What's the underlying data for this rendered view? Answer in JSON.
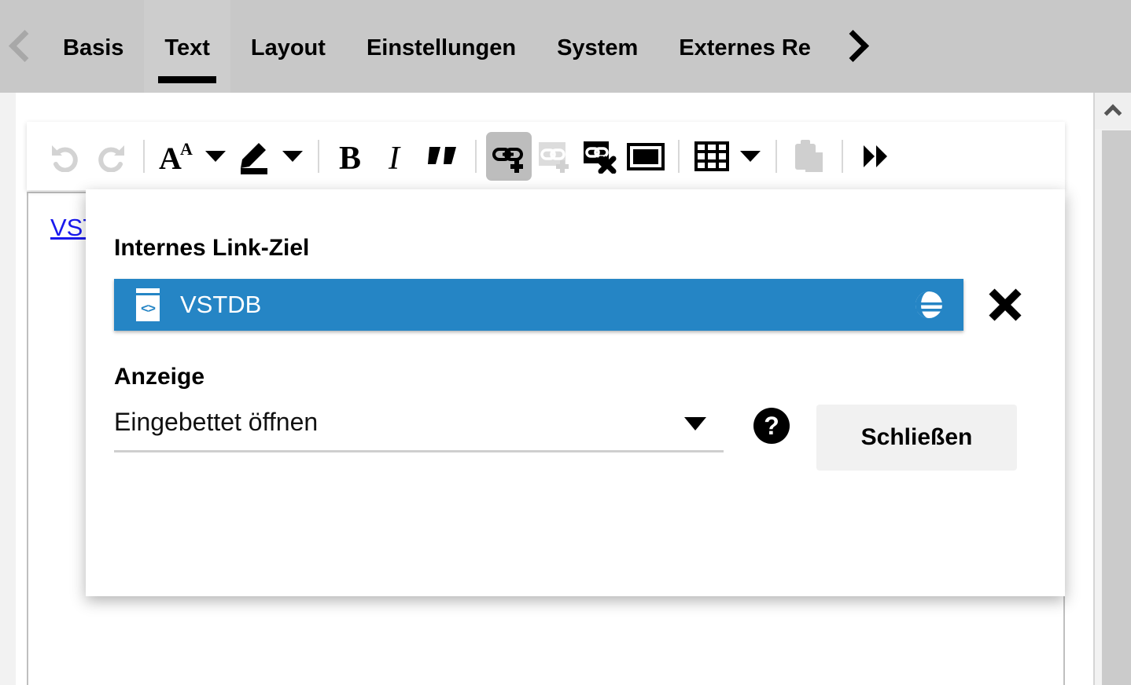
{
  "tabbar": {
    "prev_arrow": "chevron-left",
    "next_arrow": "chevron-right",
    "tabs": [
      {
        "label": "Basis",
        "active": false
      },
      {
        "label": "Text",
        "active": true
      },
      {
        "label": "Layout",
        "active": false
      },
      {
        "label": "Einstellungen",
        "active": false
      },
      {
        "label": "System",
        "active": false
      },
      {
        "label": "Externes Re",
        "active": false
      }
    ]
  },
  "toolbar": {
    "items": [
      {
        "name": "undo-icon",
        "glyph": "↶",
        "disabled": true
      },
      {
        "name": "redo-icon",
        "glyph": "↷",
        "disabled": true
      },
      {
        "name": "font-style-icon",
        "glyph": "A",
        "disabled": false
      },
      {
        "name": "font-style-dropdown-icon",
        "glyph": "▼",
        "disabled": false
      },
      {
        "name": "highlight-pen-icon",
        "glyph": "✎",
        "disabled": false
      },
      {
        "name": "highlight-dropdown-icon",
        "glyph": "▼",
        "disabled": false
      },
      {
        "name": "bold-button",
        "glyph": "B",
        "disabled": false
      },
      {
        "name": "italic-button",
        "glyph": "I",
        "disabled": false
      },
      {
        "name": "quote-button",
        "glyph": "”",
        "disabled": false
      },
      {
        "name": "insert-link-button",
        "glyph": "link+",
        "disabled": false,
        "active": true
      },
      {
        "name": "insert-external-link-button",
        "glyph": "link+",
        "disabled": true
      },
      {
        "name": "remove-link-button",
        "glyph": "link-x",
        "disabled": false
      },
      {
        "name": "insert-frame-button",
        "glyph": "frame",
        "disabled": false
      },
      {
        "name": "insert-table-button",
        "glyph": "table",
        "disabled": false
      },
      {
        "name": "table-dropdown-icon",
        "glyph": "▼",
        "disabled": false
      },
      {
        "name": "paste-button",
        "glyph": "clipboard",
        "disabled": true
      },
      {
        "name": "more-tools-button",
        "glyph": "»",
        "disabled": false
      }
    ]
  },
  "editor": {
    "link_text": "VSTDB"
  },
  "scrollbar": {
    "up_arrow": "chevron-up"
  },
  "dialog": {
    "link_target_label": "Internes Link-Ziel",
    "chip": {
      "icon": "document-code-icon",
      "text": "VSTDB",
      "browse_icon": "globe-icon",
      "code_glyph": "<>"
    },
    "clear_button": "clear-x-icon",
    "display_label": "Anzeige",
    "display_value": "Eingebettet öffnen",
    "display_caret": "caret-down-icon",
    "help_icon": "?",
    "close_label": "Schließen"
  },
  "colors": {
    "tabbar_bg": "#c8c8c8",
    "chip_blue": "#2585c5",
    "link_blue": "#1a1aee",
    "toolbar_active": "#bdbdbd",
    "button_grey": "#f1f1f1"
  }
}
